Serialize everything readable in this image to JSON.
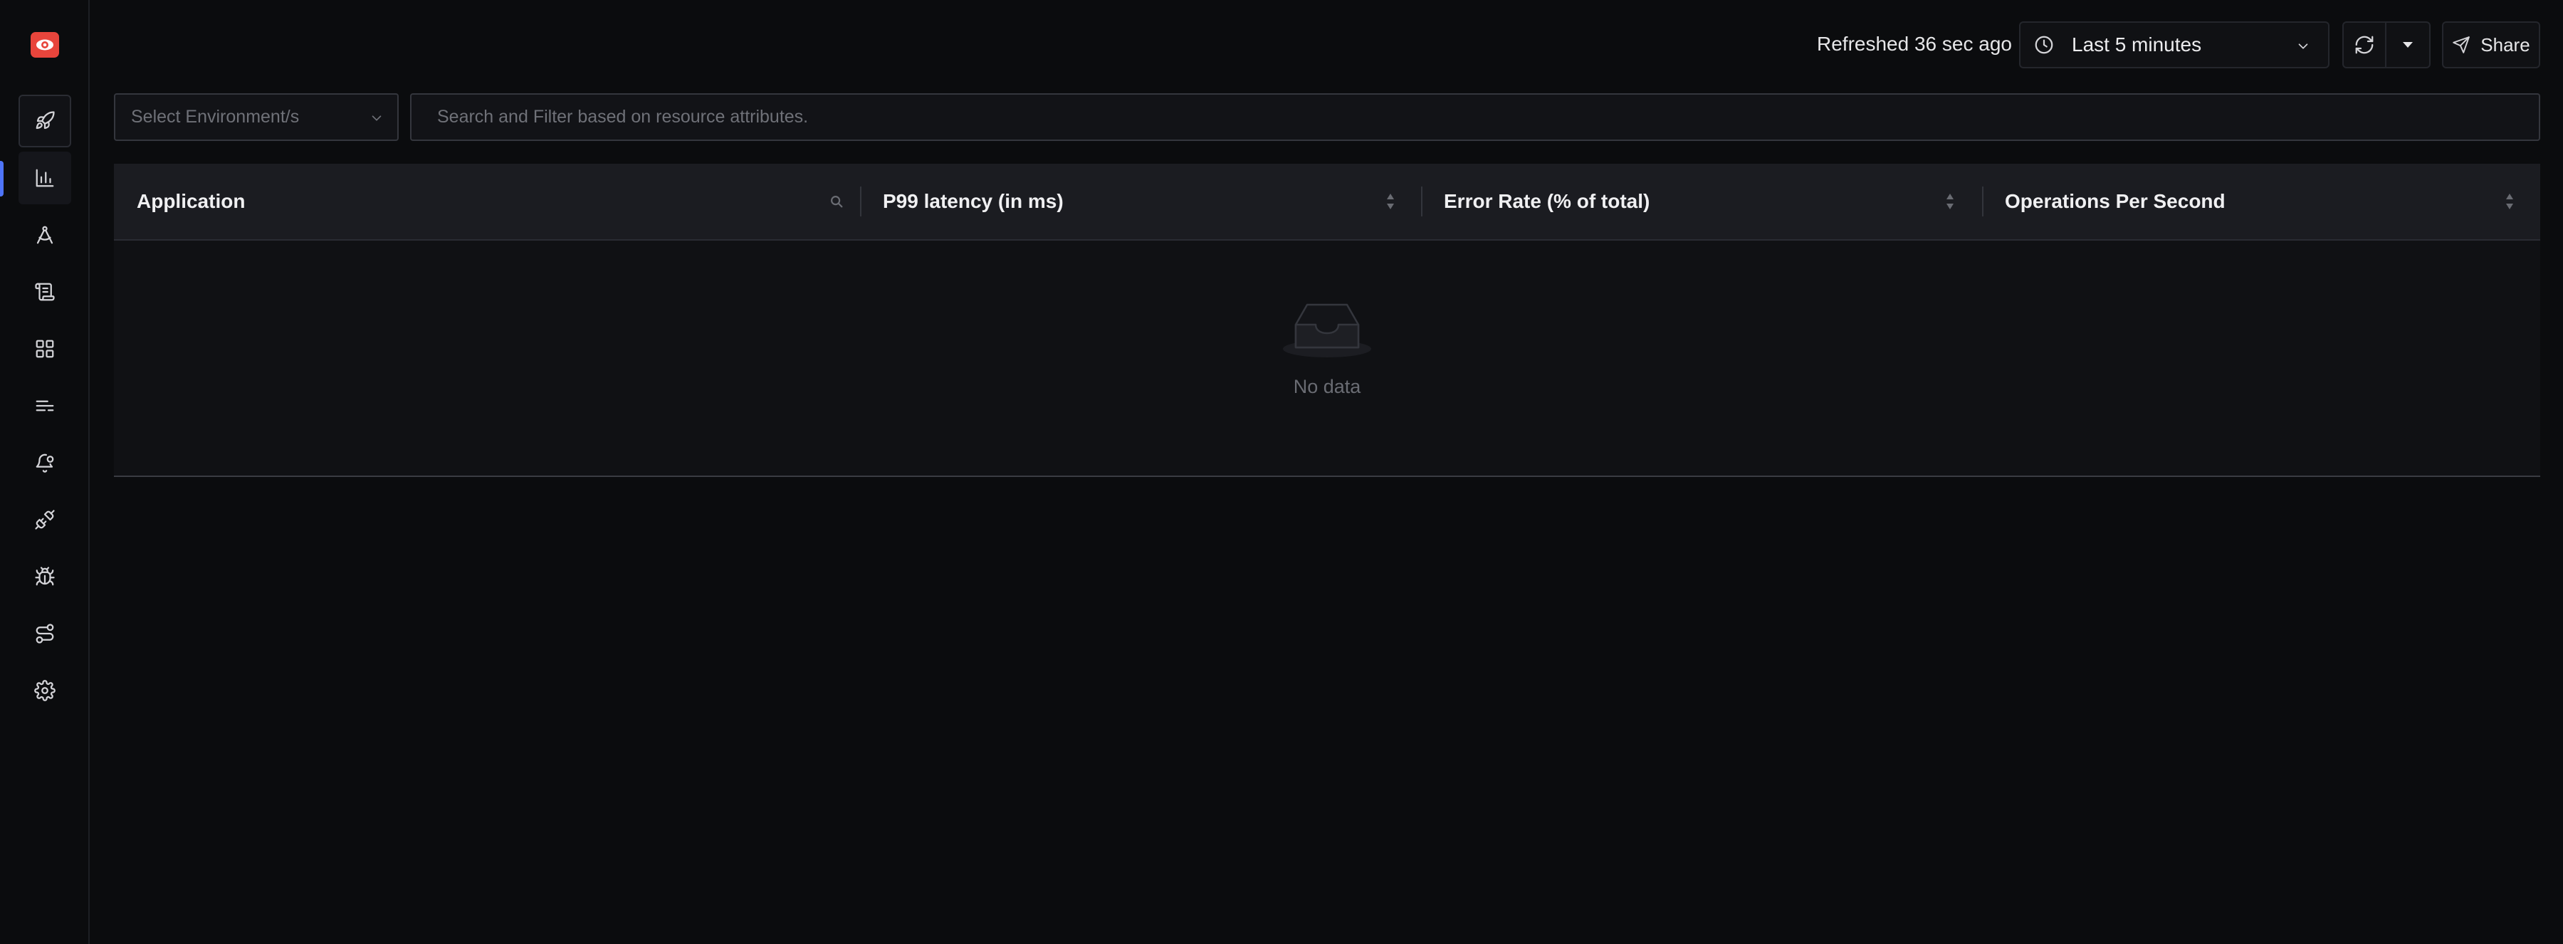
{
  "sidebar": {
    "logo": "eye-logo",
    "items": [
      {
        "name": "get-started",
        "icon": "rocket-icon"
      },
      {
        "name": "services",
        "icon": "bar-chart-icon",
        "active": true
      },
      {
        "name": "traces",
        "icon": "drafting-compass-icon"
      },
      {
        "name": "logs",
        "icon": "scroll-icon"
      },
      {
        "name": "dashboards",
        "icon": "grid-icon"
      },
      {
        "name": "messaging-queues",
        "icon": "list-bars-icon"
      },
      {
        "name": "alerts",
        "icon": "bell-icon"
      },
      {
        "name": "integrations",
        "icon": "plug-icon"
      },
      {
        "name": "exceptions",
        "icon": "bug-icon"
      },
      {
        "name": "service-map",
        "icon": "route-icon"
      },
      {
        "name": "settings",
        "icon": "gear-icon"
      }
    ]
  },
  "header": {
    "refreshed_text": "Refreshed 36 sec ago",
    "time_range": "Last 5 minutes",
    "share_label": "Share"
  },
  "filters": {
    "environment_placeholder": "Select Environment/s",
    "search_placeholder": "Search and Filter based on resource attributes.",
    "search_value": ""
  },
  "table": {
    "columns": [
      {
        "label": "Application",
        "filter": "search"
      },
      {
        "label": "P99 latency (in ms)",
        "filter": "sort"
      },
      {
        "label": "Error Rate (% of total)",
        "filter": "sort"
      },
      {
        "label": "Operations Per Second",
        "filter": "sort"
      }
    ],
    "rows": [],
    "empty_text": "No data"
  },
  "colors": {
    "background": "#0b0c0e",
    "accent": "#4e74f8",
    "brand": "#e8453c"
  }
}
